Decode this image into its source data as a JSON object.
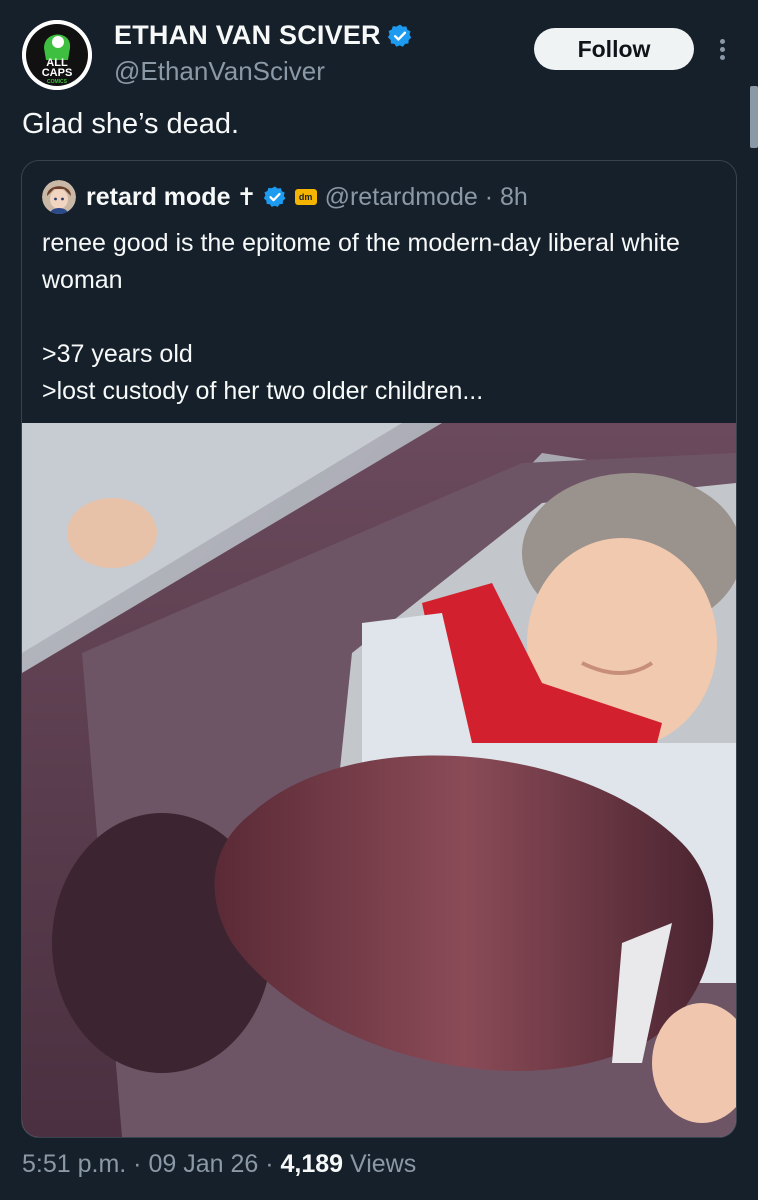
{
  "author": {
    "name": "ETHAN VAN SCIVER",
    "handle": "@EthanVanSciver",
    "avatar_logo_text": "ALL CAPS COMICS",
    "avatar_line1": "ALL",
    "avatar_line2": "CAPS",
    "avatar_line3": "COMICS",
    "verified_icon": "verified-badge-icon",
    "verified_color": "#1d9bf0"
  },
  "actions": {
    "follow_label": "Follow",
    "more_icon": "more-vertical-icon"
  },
  "tweet": {
    "text": "Glad she’s dead."
  },
  "quoted": {
    "name": "retard mode",
    "cross": "✝",
    "affiliate_badge": "dm",
    "handle_time": "@retardmode · 8h",
    "lines": [
      "renee good is the epitome of the modern-day liberal white woman",
      ">37 years old",
      ">lost custody of her two older children..."
    ]
  },
  "footer": {
    "time_date": "5:51 p.m. · 09 Jan 26 · ",
    "views_count": "4,189",
    "views_label": " Views"
  },
  "colors": {
    "background": "#15202b",
    "text": "#f7f9f9",
    "secondary": "#8b98a5",
    "border": "#38444d",
    "follow_bg": "#eff3f4"
  }
}
